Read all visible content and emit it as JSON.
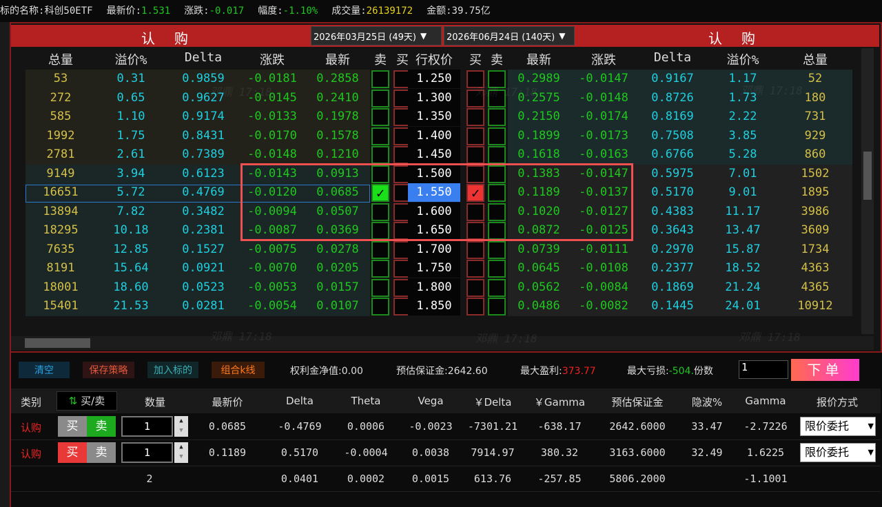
{
  "topbar": {
    "name_label": "标的名称:",
    "name": "科创50ETF",
    "last_label": "最新价:",
    "last": "1.531",
    "chg_label": "涨跌:",
    "chg": "-0.017",
    "pct_label": "幅度:",
    "pct": "-1.10%",
    "vol_label": "成交量:",
    "vol": "26139172",
    "amt_label": "金额:",
    "amt": "39.75亿"
  },
  "chain": {
    "left_title": "认 购",
    "right_title": "认 购",
    "date1": "2026年03月25日 (49天)",
    "date2": "2026年06月24日 (140天)",
    "headers": [
      "总量",
      "溢价%",
      "Delta",
      "涨跌",
      "最新",
      "卖",
      "买",
      "行权价",
      "买",
      "卖",
      "最新",
      "涨跌",
      "Delta",
      "溢价%",
      "总量"
    ],
    "rows": [
      [
        "53",
        "0.31",
        "0.9859",
        "-0.0181",
        "0.2858",
        "1.250",
        "0.2989",
        "-0.0147",
        "0.9167",
        "1.17",
        "52"
      ],
      [
        "272",
        "0.65",
        "0.9627",
        "-0.0145",
        "0.2410",
        "1.300",
        "0.2575",
        "-0.0148",
        "0.8726",
        "1.73",
        "180"
      ],
      [
        "585",
        "1.10",
        "0.9174",
        "-0.0133",
        "0.1978",
        "1.350",
        "0.2150",
        "-0.0174",
        "0.8169",
        "2.22",
        "731"
      ],
      [
        "1992",
        "1.75",
        "0.8431",
        "-0.0170",
        "0.1578",
        "1.400",
        "0.1899",
        "-0.0173",
        "0.7508",
        "3.85",
        "929"
      ],
      [
        "2781",
        "2.61",
        "0.7389",
        "-0.0148",
        "0.1210",
        "1.450",
        "0.1618",
        "-0.0163",
        "0.6766",
        "5.28",
        "860"
      ],
      [
        "9149",
        "3.94",
        "0.6123",
        "-0.0143",
        "0.0913",
        "1.500",
        "0.1383",
        "-0.0147",
        "0.5975",
        "7.01",
        "1502"
      ],
      [
        "16651",
        "5.72",
        "0.4769",
        "-0.0120",
        "0.0685",
        "1.550",
        "0.1189",
        "-0.0137",
        "0.5170",
        "9.01",
        "1895"
      ],
      [
        "13894",
        "7.82",
        "0.3482",
        "-0.0094",
        "0.0507",
        "1.600",
        "0.1020",
        "-0.0127",
        "0.4383",
        "11.17",
        "3986"
      ],
      [
        "18295",
        "10.18",
        "0.2381",
        "-0.0087",
        "0.0369",
        "1.650",
        "0.0872",
        "-0.0125",
        "0.3643",
        "13.47",
        "3609"
      ],
      [
        "7635",
        "12.85",
        "0.1527",
        "-0.0075",
        "0.0278",
        "1.700",
        "0.0739",
        "-0.0111",
        "0.2970",
        "15.87",
        "1734"
      ],
      [
        "8191",
        "15.64",
        "0.0921",
        "-0.0070",
        "0.0205",
        "1.750",
        "0.0645",
        "-0.0108",
        "0.2377",
        "18.52",
        "4363"
      ],
      [
        "18001",
        "18.60",
        "0.0523",
        "-0.0053",
        "0.0157",
        "1.800",
        "0.0562",
        "-0.0084",
        "0.1869",
        "21.24",
        "4365"
      ],
      [
        "15401",
        "21.53",
        "0.0281",
        "-0.0054",
        "0.0107",
        "1.850",
        "0.0486",
        "-0.0082",
        "0.1445",
        "24.01",
        "10912"
      ]
    ],
    "selected_strike": "1.550",
    "check_mark": "✓",
    "watermark": "邓鼎 17:18"
  },
  "toolbar": {
    "clear": "清空",
    "save": "保存策略",
    "add": "加入标的",
    "combo": "组合k线",
    "premium_label": "权利金净值:",
    "premium": "0.00",
    "margin_label": "预估保证金:",
    "margin": "2642.60",
    "maxprofit_label": "最大盈利:",
    "maxprofit": "373.77",
    "maxloss_label": "最大亏损:",
    "maxloss": "-504.",
    "copies_label": "份数",
    "copies": "1",
    "order": "下单"
  },
  "legs": {
    "headers": [
      "类别",
      "买/卖",
      "数量",
      "最新价",
      "Delta",
      "Theta",
      "Vega",
      "￥Delta",
      "￥Gamma",
      "预估保证金",
      "隐波%",
      "Gamma",
      "报价方式"
    ],
    "buy": "买",
    "sell": "卖",
    "rows": [
      {
        "type": "认购",
        "qty": "1",
        "last": "0.0685",
        "delta": "-0.4769",
        "theta": "0.0006",
        "vega": "-0.0023",
        "ydelta": "-7301.21",
        "ygamma": "-638.17",
        "margin": "2642.6000",
        "iv": "33.47",
        "gamma": "-2.7226",
        "price_type": "限价委托",
        "side": "sell"
      },
      {
        "type": "认购",
        "qty": "1",
        "last": "0.1189",
        "delta": "0.5170",
        "theta": "-0.0004",
        "vega": "0.0038",
        "ydelta": "7914.97",
        "ygamma": "380.32",
        "margin": "3163.6000",
        "iv": "32.49",
        "gamma": "1.6225",
        "price_type": "限价委托",
        "side": "buy"
      }
    ],
    "total": {
      "qty": "2",
      "delta": "0.0401",
      "theta": "0.0002",
      "vega": "0.0015",
      "ydelta": "613.76",
      "ygamma": "-257.85",
      "margin": "5806.2000",
      "gamma": "-1.1001"
    }
  },
  "colors": {
    "band": "#b52020",
    "yellow": "#e6d21e",
    "cyan": "#1ecfe0",
    "green": "#1ec81e",
    "red": "#e22"
  }
}
